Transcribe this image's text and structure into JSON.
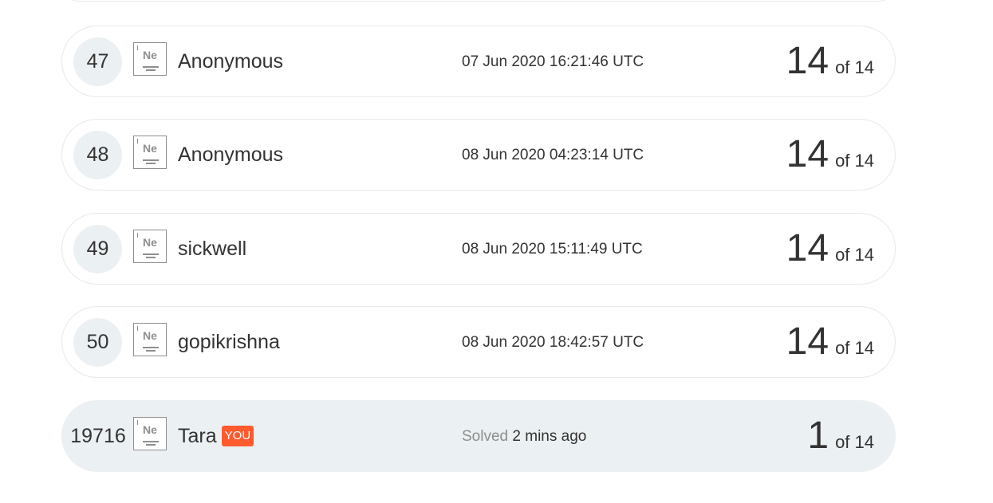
{
  "leaderboard": {
    "rows": [
      {
        "rank": "47",
        "element": "Ne",
        "name": "Anonymous",
        "time": "07 Jun 2020 16:21:46 UTC",
        "score": "14",
        "of_text": "of 14"
      },
      {
        "rank": "48",
        "element": "Ne",
        "name": "Anonymous",
        "time": "08 Jun 2020 04:23:14 UTC",
        "score": "14",
        "of_text": "of 14"
      },
      {
        "rank": "49",
        "element": "Ne",
        "name": "sickwell",
        "time": "08 Jun 2020 15:11:49 UTC",
        "score": "14",
        "of_text": "of 14"
      },
      {
        "rank": "50",
        "element": "Ne",
        "name": "gopikrishna",
        "time": "08 Jun 2020 18:42:57 UTC",
        "score": "14",
        "of_text": "of 14"
      }
    ],
    "me": {
      "rank": "19716",
      "element": "Ne",
      "name": "Tara",
      "you_tag": "YOU",
      "solved_label": "Solved",
      "solved_time": "2 mins ago",
      "score": "1",
      "of_text": "of 14"
    }
  },
  "colors": {
    "row_border": "#e6e9ec",
    "rank_bg": "#ebf0f2",
    "you_tag": "#ff5b2e",
    "badge": "#8e8e8e"
  },
  "icons": {
    "badge": "element-badge-icon"
  }
}
